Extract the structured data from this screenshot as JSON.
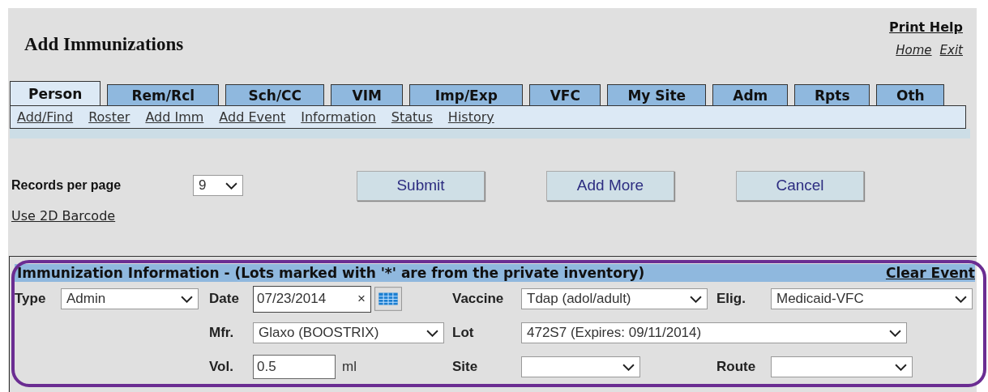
{
  "page": {
    "title": "Add Immunizations"
  },
  "top_links": {
    "print_help": "Print Help",
    "home": "Home",
    "exit": "Exit"
  },
  "tabs": [
    {
      "label": "Person",
      "selected": true
    },
    {
      "label": "Rem/Rcl",
      "selected": false
    },
    {
      "label": "Sch/CC",
      "selected": false
    },
    {
      "label": "VIM",
      "selected": false
    },
    {
      "label": "Imp/Exp",
      "selected": false
    },
    {
      "label": "VFC",
      "selected": false
    },
    {
      "label": "My Site",
      "selected": false
    },
    {
      "label": "Adm",
      "selected": false
    },
    {
      "label": "Rpts",
      "selected": false
    },
    {
      "label": "Oth",
      "selected": false
    }
  ],
  "subnav": [
    "Add/Find",
    "Roster",
    "Add Imm",
    "Add Event",
    "Information",
    "Status",
    "History"
  ],
  "records_per_page": {
    "label": "Records per page",
    "value": "9"
  },
  "buttons": [
    "Submit",
    "Add More",
    "Cancel"
  ],
  "barcode_link": "Use 2D Barcode",
  "section": {
    "title": "Immunization Information - (Lots marked with '*' are from the private inventory)",
    "clear_link": "Clear Event",
    "rows": [
      [
        {
          "label": "Type",
          "kind": "select",
          "value": "Admin"
        },
        {
          "label": "Date",
          "kind": "date",
          "value": "07/23/2014",
          "clear": "×"
        },
        {
          "label": "Vaccine",
          "kind": "select",
          "value": "Tdap (adol/adult)"
        },
        {
          "label": "Elig.",
          "kind": "select",
          "value": "Medicaid-VFC"
        }
      ],
      [
        "",
        {
          "label": "Mfr.",
          "kind": "select",
          "value": "Glaxo (BOOSTRIX)"
        },
        {
          "label": "Lot",
          "kind": "select",
          "value": "472S7 (Expires: 09/11/2014)"
        }
      ],
      [
        "",
        {
          "label": "Vol.",
          "kind": "text",
          "value": "0.5",
          "unit": "ml"
        },
        {
          "label": "Site",
          "kind": "select"
        },
        {
          "label": "Route",
          "kind": "select"
        }
      ]
    ]
  }
}
